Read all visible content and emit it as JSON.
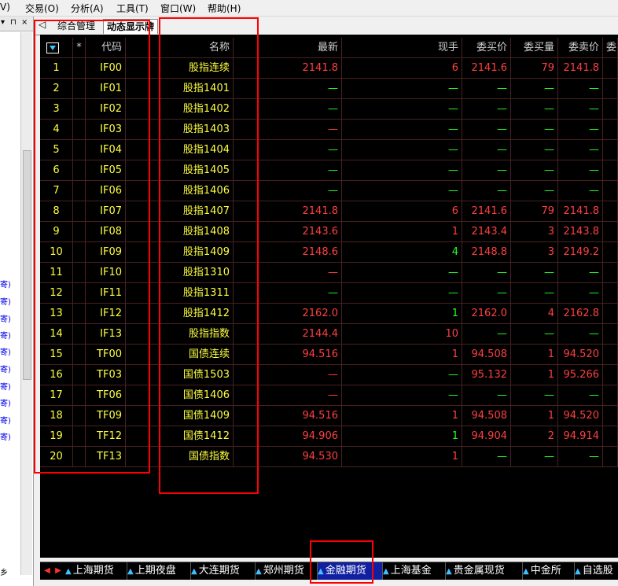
{
  "menu": [
    "V)",
    "交易(O)",
    "分析(A)",
    "工具(T)",
    "窗口(W)",
    "帮助(H)"
  ],
  "left_panel": {
    "header_icons": [
      "▾",
      "⊓",
      "×"
    ],
    "links": [
      "寄)",
      "寄)",
      "寄)",
      "寄)",
      "寄)",
      "寄)",
      "寄)",
      "寄)",
      "寄)",
      "寄)"
    ],
    "bottom_glyph": "乡"
  },
  "tabs": [
    {
      "label": "◁"
    },
    {
      "label": "综合管理"
    },
    {
      "label": "动态显示牌"
    }
  ],
  "table": {
    "headers": [
      "",
      "*",
      "代码",
      "名称",
      "最新",
      "现手",
      "委买价",
      "委买量",
      "委卖价",
      "委"
    ],
    "rows": [
      {
        "n": "1",
        "code": "IF00",
        "name": "股指连续",
        "last": "2141.8",
        "vol": "6",
        "bid": "2141.6",
        "bidq": "79",
        "ask": "2141.8",
        "last_c": "red",
        "vol_c": "red"
      },
      {
        "n": "2",
        "code": "IF01",
        "name": "股指1401",
        "last": "—",
        "vol": "—",
        "bid": "—",
        "bidq": "—",
        "ask": "—",
        "last_c": "grn",
        "vol_c": "grn"
      },
      {
        "n": "3",
        "code": "IF02",
        "name": "股指1402",
        "last": "—",
        "vol": "—",
        "bid": "—",
        "bidq": "—",
        "ask": "—",
        "last_c": "grn",
        "vol_c": "grn"
      },
      {
        "n": "4",
        "code": "IF03",
        "name": "股指1403",
        "last": "—",
        "vol": "—",
        "bid": "—",
        "bidq": "—",
        "ask": "—",
        "last_c": "red",
        "vol_c": "grn"
      },
      {
        "n": "5",
        "code": "IF04",
        "name": "股指1404",
        "last": "—",
        "vol": "—",
        "bid": "—",
        "bidq": "—",
        "ask": "—",
        "last_c": "grn",
        "vol_c": "grn"
      },
      {
        "n": "6",
        "code": "IF05",
        "name": "股指1405",
        "last": "—",
        "vol": "—",
        "bid": "—",
        "bidq": "—",
        "ask": "—",
        "last_c": "grn",
        "vol_c": "grn"
      },
      {
        "n": "7",
        "code": "IF06",
        "name": "股指1406",
        "last": "—",
        "vol": "—",
        "bid": "—",
        "bidq": "—",
        "ask": "—",
        "last_c": "grn",
        "vol_c": "grn"
      },
      {
        "n": "8",
        "code": "IF07",
        "name": "股指1407",
        "last": "2141.8",
        "vol": "6",
        "bid": "2141.6",
        "bidq": "79",
        "ask": "2141.8",
        "last_c": "red",
        "vol_c": "red"
      },
      {
        "n": "9",
        "code": "IF08",
        "name": "股指1408",
        "last": "2143.6",
        "vol": "1",
        "bid": "2143.4",
        "bidq": "3",
        "ask": "2143.8",
        "last_c": "red",
        "vol_c": "red"
      },
      {
        "n": "10",
        "code": "IF09",
        "name": "股指1409",
        "last": "2148.6",
        "vol": "4",
        "bid": "2148.8",
        "bidq": "3",
        "ask": "2149.2",
        "last_c": "red",
        "vol_c": "grn"
      },
      {
        "n": "11",
        "code": "IF10",
        "name": "股指1310",
        "last": "—",
        "vol": "—",
        "bid": "—",
        "bidq": "—",
        "ask": "—",
        "last_c": "red",
        "vol_c": "grn"
      },
      {
        "n": "12",
        "code": "IF11",
        "name": "股指1311",
        "last": "—",
        "vol": "—",
        "bid": "—",
        "bidq": "—",
        "ask": "—",
        "last_c": "grn",
        "vol_c": "grn"
      },
      {
        "n": "13",
        "code": "IF12",
        "name": "股指1412",
        "last": "2162.0",
        "vol": "1",
        "bid": "2162.0",
        "bidq": "4",
        "ask": "2162.8",
        "last_c": "red",
        "vol_c": "grn"
      },
      {
        "n": "14",
        "code": "IF13",
        "name": "股指指数",
        "last": "2144.4",
        "vol": "10",
        "bid": "—",
        "bidq": "—",
        "ask": "—",
        "last_c": "red",
        "vol_c": "red"
      },
      {
        "n": "15",
        "code": "TF00",
        "name": "国债连续",
        "last": "94.516",
        "vol": "1",
        "bid": "94.508",
        "bidq": "1",
        "ask": "94.520",
        "last_c": "red",
        "vol_c": "red"
      },
      {
        "n": "16",
        "code": "TF03",
        "name": "国债1503",
        "last": "—",
        "vol": "—",
        "bid": "95.132",
        "bidq": "1",
        "ask": "95.266",
        "last_c": "red",
        "vol_c": "grn"
      },
      {
        "n": "17",
        "code": "TF06",
        "name": "国债1406",
        "last": "—",
        "vol": "—",
        "bid": "—",
        "bidq": "—",
        "ask": "—",
        "last_c": "red",
        "vol_c": "grn"
      },
      {
        "n": "18",
        "code": "TF09",
        "name": "国债1409",
        "last": "94.516",
        "vol": "1",
        "bid": "94.508",
        "bidq": "1",
        "ask": "94.520",
        "last_c": "red",
        "vol_c": "red"
      },
      {
        "n": "19",
        "code": "TF12",
        "name": "国债1412",
        "last": "94.906",
        "vol": "1",
        "bid": "94.904",
        "bidq": "2",
        "ask": "94.914",
        "last_c": "red",
        "vol_c": "grn"
      },
      {
        "n": "20",
        "code": "TF13",
        "name": "国债指数",
        "last": "94.530",
        "vol": "1",
        "bid": "—",
        "bidq": "—",
        "ask": "—",
        "last_c": "red",
        "vol_c": "red"
      }
    ]
  },
  "bottom_tabs": [
    {
      "label": "上海期货",
      "active": false
    },
    {
      "label": "上期夜盘",
      "active": false
    },
    {
      "label": "大连期货",
      "active": false
    },
    {
      "label": "郑州期货",
      "active": false
    },
    {
      "label": "金融期货",
      "active": true
    },
    {
      "label": "上海基金",
      "active": false
    },
    {
      "label": "贵金属现货",
      "active": false
    },
    {
      "label": "中金所",
      "active": false
    },
    {
      "label": "自选股",
      "active": false
    }
  ],
  "colors": {
    "up": "#ff4040",
    "flat": "#20ff20",
    "code": "#ffff40",
    "grid": "#4a2020",
    "highlight": "#ff0000",
    "active_tab": "#1020a0"
  }
}
